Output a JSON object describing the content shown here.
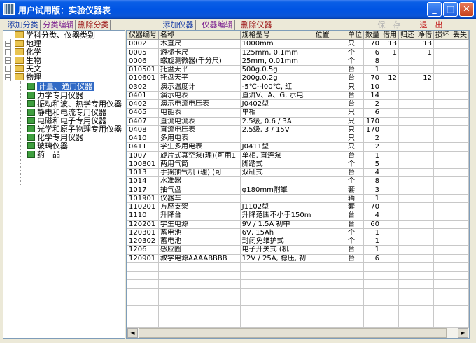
{
  "window": {
    "title": "用户试用版：实验仪器表",
    "min": "_",
    "max": "□",
    "close": "✕"
  },
  "toolbar": {
    "add_category": "添加分类",
    "edit_category": "分类编辑",
    "delete_category": "删除分类",
    "add_instrument": "添加仪器",
    "edit_instrument": "仪器编辑",
    "delete_instrument": "删除仪器",
    "save": "保　存",
    "exit": "退　出"
  },
  "tree": {
    "root": "学科分类、仪器类别",
    "subjects": [
      "地理",
      "化学",
      "生物",
      "天文",
      "物理"
    ],
    "physics_children": [
      "计量、通用仪器",
      "力学专用仪器",
      "振动和波、热学专用仪器",
      "静电和电流专用仪器",
      "电磁和电子专用仪器",
      "光学和原子物理专用仪器",
      "化学专用仪器",
      "玻璃仪器",
      "药　品"
    ],
    "selected": "计量、通用仪器"
  },
  "grid": {
    "columns": [
      "仪器编号",
      "名称",
      "规格型号",
      "位置",
      "单位",
      "数量",
      "借用",
      "归还",
      "净借",
      "损坏",
      "丢失"
    ],
    "rows": [
      [
        "0002",
        "木直尺",
        "1000mm",
        "",
        "只",
        "70",
        "13",
        "",
        "13",
        "",
        ""
      ],
      [
        "0005",
        "游标卡尺",
        "125mm, 0.1mm",
        "",
        "个",
        "6",
        "1",
        "",
        "1",
        "",
        ""
      ],
      [
        "0006",
        "螺旋测微器(千分尺)",
        "25mm, 0.01mm",
        "",
        "个",
        "8",
        "",
        "",
        "",
        "",
        ""
      ],
      [
        "010501",
        "托盘天平",
        "500g.0.5g",
        "",
        "台",
        "1",
        "",
        "",
        "",
        "",
        ""
      ],
      [
        "010601",
        "托盘天平",
        "200g.0.2g",
        "",
        "台",
        "70",
        "12",
        "",
        "12",
        "",
        ""
      ],
      [
        "0302",
        "演示温度计",
        "-5℃--l00℃, 红",
        "",
        "只",
        "10",
        "",
        "",
        "",
        "",
        ""
      ],
      [
        "0401",
        "演示电表",
        "直流V、A、G, 示电",
        "",
        "台",
        "14",
        "",
        "",
        "",
        "",
        ""
      ],
      [
        "0402",
        "演示电流电压表",
        "J0402型",
        "",
        "台",
        "2",
        "",
        "",
        "",
        "",
        ""
      ],
      [
        "0405",
        "电能表",
        "单相",
        "",
        "只",
        "6",
        "",
        "",
        "",
        "",
        ""
      ],
      [
        "0407",
        "直流电流表",
        "2.5级, 0.6 / 3A",
        "",
        "只",
        "170",
        "",
        "",
        "",
        "",
        ""
      ],
      [
        "0408",
        "直流电压表",
        "2.5级, 3 / 15V",
        "",
        "只",
        "170",
        "",
        "",
        "",
        "",
        ""
      ],
      [
        "0410",
        "多用电表",
        "",
        "",
        "只",
        "2",
        "",
        "",
        "",
        "",
        ""
      ],
      [
        "0411",
        "学生多用电表",
        "J0411型",
        "",
        "只",
        "2",
        "",
        "",
        "",
        "",
        ""
      ],
      [
        "1007",
        "旋片式真空泵(理)(可用1",
        "单相, 直连泵",
        "",
        "台",
        "1",
        "",
        "",
        "",
        "",
        ""
      ],
      [
        "100801",
        "两用气筒",
        "脚踏式",
        "",
        "个",
        "5",
        "",
        "",
        "",
        "",
        ""
      ],
      [
        "1013",
        "手摇抽气机 (理) (可",
        "双缸式",
        "",
        "台",
        "4",
        "",
        "",
        "",
        "",
        ""
      ],
      [
        "1014",
        "水准器",
        "",
        "",
        "个",
        "8",
        "",
        "",
        "",
        "",
        ""
      ],
      [
        "1017",
        "抽气盘",
        "φ180mm附罩",
        "",
        "套",
        "3",
        "",
        "",
        "",
        "",
        ""
      ],
      [
        "101901",
        "仪器车",
        "",
        "",
        "辆",
        "1",
        "",
        "",
        "",
        "",
        ""
      ],
      [
        "110201",
        "方座支架",
        "J1102型",
        "",
        "套",
        "70",
        "",
        "",
        "",
        "",
        ""
      ],
      [
        "1110",
        "升降台",
        "升降范围不小于150m",
        "",
        "台",
        "4",
        "",
        "",
        "",
        "",
        ""
      ],
      [
        "120201",
        "学生电源",
        "9V / 1.5A 初中",
        "",
        "台",
        "60",
        "",
        "",
        "",
        "",
        ""
      ],
      [
        "120301",
        "蓄电池",
        "6V, 15Ah",
        "",
        "个",
        "1",
        "",
        "",
        "",
        "",
        ""
      ],
      [
        "120302",
        "蓄电池",
        "封闭免维护式",
        "",
        "个",
        "1",
        "",
        "",
        "",
        "",
        ""
      ],
      [
        "1206",
        "感应圈",
        "电子开关式 (机",
        "",
        "台",
        "1",
        "",
        "",
        "",
        "",
        ""
      ],
      [
        "120901",
        "教学电源AAAABBBB",
        "12V / 25A, 稳压, 初",
        "",
        "台",
        "6",
        "",
        "",
        "",
        "",
        ""
      ]
    ],
    "empty_rows": 8
  },
  "scrollbar": {
    "left": "◄",
    "right": "►"
  }
}
